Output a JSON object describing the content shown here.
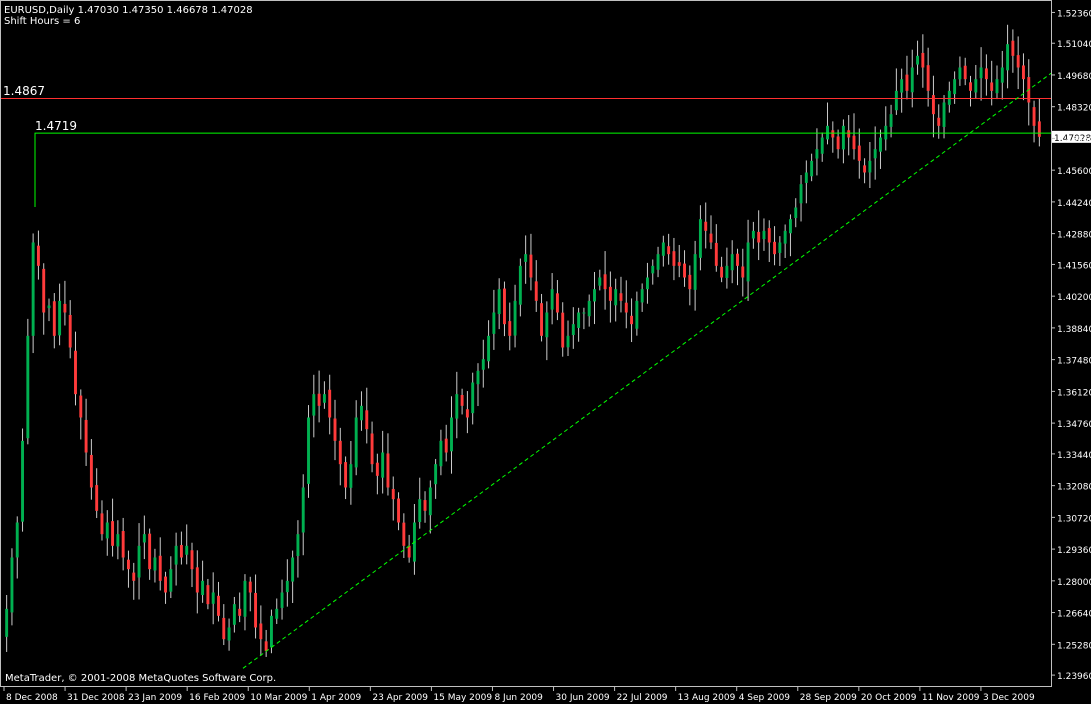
{
  "header": {
    "symbol_line": "EURUSD,Daily  1.47030 1.47350 1.46678 1.47028",
    "shift_line": "Shift Hours = 6"
  },
  "footer": {
    "copyright": "MetaTrader, © 2001-2008 MetaQuotes Software Corp."
  },
  "colors": {
    "background": "#000000",
    "frame": "#c0c0c0",
    "bull": "#00b050",
    "bear": "#ff3b3b",
    "wick": "#cccccc",
    "resistance": "#ff3030",
    "support": "#00ff00",
    "trendline": "#00ff00",
    "axis_text": "#ffffff"
  },
  "chart_data": {
    "type": "candlestick",
    "title": "EURUSD,Daily",
    "ohlc_last": {
      "open": "1.47030",
      "high": "1.47350",
      "low": "1.46678",
      "close": "1.47028"
    },
    "ylim": [
      1.2345,
      1.5285
    ],
    "y_ticks": [
      "1.52360",
      "1.51040",
      "1.49680",
      "1.48320",
      "1.46960",
      "1.45600",
      "1.44240",
      "1.42880",
      "1.41560",
      "1.40200",
      "1.38840",
      "1.37480",
      "1.36120",
      "1.34760",
      "1.33440",
      "1.32080",
      "1.30720",
      "1.29360",
      "1.28000",
      "1.26640",
      "1.25280",
      "1.23960"
    ],
    "x_ticks": [
      "8 Dec 2008",
      "31 Dec 2008",
      "23 Jan 2009",
      "16 Feb 2009",
      "10 Mar 2009",
      "1 Apr 2009",
      "23 Apr 2009",
      "15 May 2009",
      "8 Jun 2009",
      "30 Jun 2009",
      "22 Jul 2009",
      "13 Aug 2009",
      "4 Sep 2009",
      "28 Sep 2009",
      "20 Oct 2009",
      "11 Nov 2009",
      "3 Dec 2009"
    ],
    "current_price": "1.47028",
    "horizontal_lines": [
      {
        "label": "1.4867",
        "value": 1.4867,
        "color": "#ff3030"
      },
      {
        "label": "1.4719",
        "value": 1.4719,
        "color": "#00ff00"
      }
    ],
    "trendline": {
      "from": {
        "date": "19 Feb 2009",
        "price": 1.2425
      },
      "to": {
        "date": "8 Dec 2009",
        "price": 1.4975
      },
      "style": "dashed"
    },
    "closes": [
      1.268,
      1.29,
      1.305,
      1.34,
      1.385,
      1.425,
      1.415,
      1.395,
      1.398,
      1.385,
      1.4,
      1.395,
      1.38,
      1.36,
      1.35,
      1.335,
      1.32,
      1.31,
      1.3,
      1.305,
      1.295,
      1.3,
      1.29,
      1.285,
      1.28,
      1.295,
      1.3,
      1.285,
      1.29,
      1.28,
      1.275,
      1.285,
      1.295,
      1.29,
      1.295,
      1.285,
      1.275,
      1.28,
      1.27,
      1.275,
      1.265,
      1.255,
      1.26,
      1.27,
      1.265,
      1.28,
      1.275,
      1.26,
      1.255,
      1.25,
      1.265,
      1.268,
      1.275,
      1.28,
      1.29,
      1.3,
      1.32,
      1.35,
      1.36,
      1.355,
      1.36,
      1.35,
      1.34,
      1.33,
      1.32,
      1.33,
      1.35,
      1.355,
      1.345,
      1.33,
      1.325,
      1.335,
      1.32,
      1.315,
      1.305,
      1.295,
      1.29,
      1.305,
      1.315,
      1.31,
      1.32,
      1.33,
      1.34,
      1.335,
      1.35,
      1.36,
      1.355,
      1.35,
      1.365,
      1.37,
      1.375,
      1.385,
      1.395,
      1.405,
      1.39,
      1.385,
      1.4,
      1.415,
      1.42,
      1.41,
      1.4,
      1.385,
      1.395,
      1.405,
      1.395,
      1.38,
      1.385,
      1.39,
      1.395,
      1.395,
      1.4,
      1.405,
      1.41,
      1.405,
      1.4,
      1.405,
      1.4,
      1.395,
      1.39,
      1.4,
      1.405,
      1.41,
      1.415,
      1.42,
      1.425,
      1.42,
      1.415,
      1.415,
      1.41,
      1.405,
      1.42,
      1.435,
      1.43,
      1.425,
      1.415,
      1.41,
      1.415,
      1.42,
      1.415,
      1.41,
      1.425,
      1.43,
      1.425,
      1.43,
      1.425,
      1.42,
      1.425,
      1.43,
      1.435,
      1.44,
      1.45,
      1.455,
      1.46,
      1.465,
      1.47,
      1.475,
      1.47,
      1.465,
      1.475,
      1.47,
      1.465,
      1.46,
      1.455,
      1.46,
      1.465,
      1.47,
      1.475,
      1.48,
      1.49,
      1.495,
      1.49,
      1.5,
      1.505,
      1.5,
      1.49,
      1.48,
      1.475,
      1.485,
      1.49,
      1.495,
      1.5,
      1.495,
      1.49,
      1.495,
      1.5,
      1.495,
      1.49,
      1.495,
      1.5,
      1.51,
      1.505,
      1.5,
      1.495,
      1.485,
      1.475,
      1.4703
    ]
  }
}
